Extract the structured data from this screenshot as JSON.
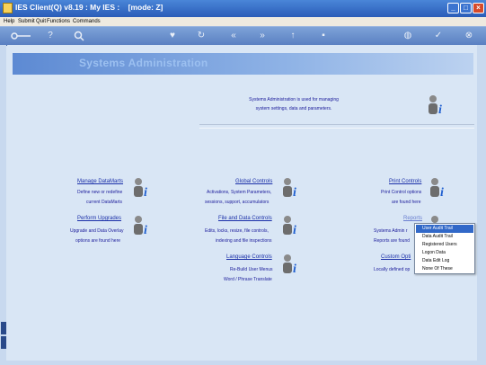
{
  "window": {
    "title": "IES Client(Q) v8.19 : My IES :    [mode: Z]"
  },
  "menubar": {
    "items": [
      "Help",
      "Submit",
      "Quit",
      "Functions",
      "Commands"
    ]
  },
  "toolbar": {
    "icons": [
      "key-icon",
      "help-icon",
      "search-icon",
      "heart-icon",
      "refresh-icon",
      "back-icon",
      "forward-icon",
      "up-icon",
      "pin-icon",
      "globe-icon",
      "check-icon",
      "cancel-icon"
    ]
  },
  "banner": {
    "title": "Systems Administration"
  },
  "intro": {
    "line1": "Systems Administration is used for managing",
    "line2": "system settings, data and parameters."
  },
  "sections": {
    "manage_datamarts": {
      "title": "Manage DataMarts",
      "line1": "Define new or redefine",
      "line2": "current DataMarts"
    },
    "global_controls": {
      "title": "Global Controls",
      "line1": "Activations, System Parameters,",
      "line2": "sessions, support, accumulators"
    },
    "print_controls": {
      "title": "Print Controls",
      "line1": "Print Control options",
      "line2": "are found here"
    },
    "perform_upgrades": {
      "title": "Perform Upgrades",
      "line1": "Upgrade and Data Overlay",
      "line2": "options are found here"
    },
    "file_data_controls": {
      "title": "File and Data Controls",
      "line1": "Edits, locks, resize, file controls,",
      "line2": "indexing and file inspections"
    },
    "reports": {
      "title": "Reports",
      "line1": "Systems Admin r",
      "line2": "Reports are found"
    },
    "language_controls": {
      "title": "Language Controls",
      "line1": "Re-Build User Menus",
      "line2": "Word / Phrase Translate"
    },
    "custom_options": {
      "title": "Custom Opti",
      "line1": "Locally defined op"
    }
  },
  "popup": {
    "items": [
      "User Audit Trail",
      "Data Audit Trail",
      "Registered Users",
      "Logon Data",
      "Data Edit Log",
      "None Of These"
    ],
    "selected_index": 0
  }
}
